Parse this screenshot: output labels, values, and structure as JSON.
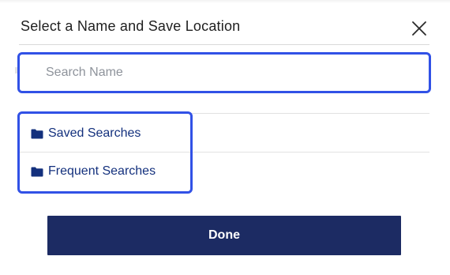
{
  "dialog": {
    "title": "Select a Name and Save Location",
    "close_icon": "close-icon"
  },
  "search": {
    "placeholder": "Search Name",
    "value": ""
  },
  "folders": {
    "items": [
      {
        "label": "Saved Searches",
        "icon": "folder-icon"
      },
      {
        "label": "Frequent Searches",
        "icon": "folder-icon"
      }
    ]
  },
  "actions": {
    "done_label": "Done"
  },
  "colors": {
    "focus_outline": "#3151e6",
    "folder_text": "#13307d",
    "done_button_bg": "#1c2b63",
    "title_text": "#1f1f1f"
  }
}
